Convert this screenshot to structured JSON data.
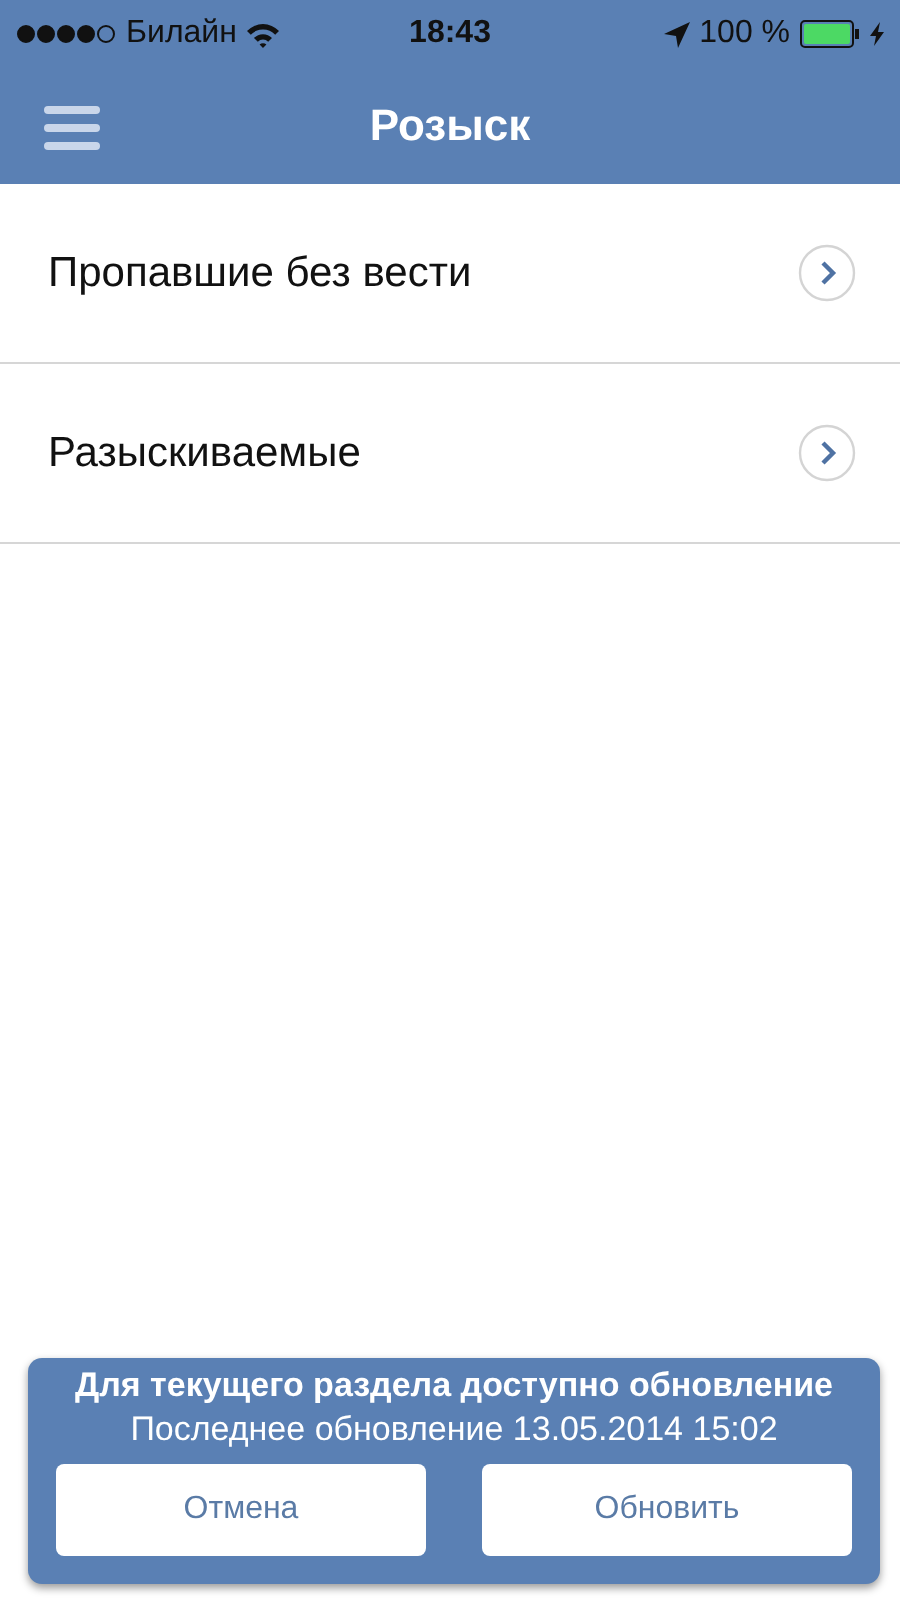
{
  "status_bar": {
    "carrier": "Билайн",
    "time": "18:43",
    "battery": "100 %"
  },
  "nav_bar": {
    "title": "Розыск"
  },
  "items": [
    {
      "label": "Пропавшие без вести"
    },
    {
      "label": "Разыскиваемые"
    }
  ],
  "update_panel": {
    "title": "Для текущего раздела доступно обновление",
    "subtitle": "Последнее обновление 13.05.2014 15:02",
    "buttons": [
      "Отмена",
      "Обновить"
    ]
  }
}
